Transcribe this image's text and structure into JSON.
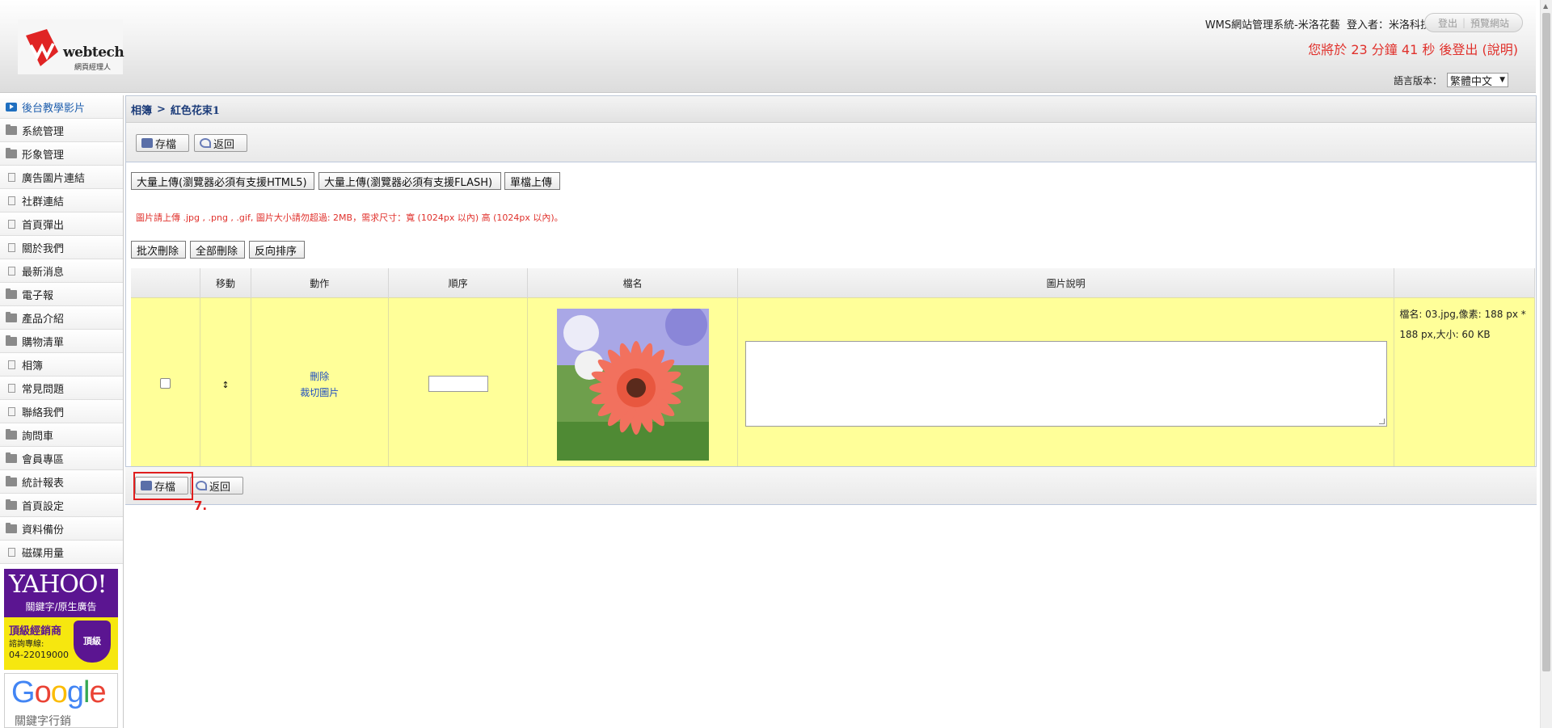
{
  "header": {
    "logo_brand": "webtech",
    "logo_sub": "網頁經理人",
    "system_title": "WMS網站管理系統-米洛花藝",
    "login_label": "登入者：米洛科技",
    "logout_btn": "登出",
    "preview_btn": "預覽網站",
    "logout_timer": "您將於 23 分鐘 41 秒 後登出 (說明)",
    "lang_label": "語言版本：",
    "lang_value": "繁體中文",
    "colors": {
      "timer": "#e0312c",
      "logo_red": "#e02424"
    }
  },
  "sidebar": {
    "items": [
      {
        "label": "後台教學影片",
        "icon": "video-icon",
        "active": true
      },
      {
        "label": "系統管理",
        "icon": "folder-icon"
      },
      {
        "label": "形象管理",
        "icon": "folder-icon"
      },
      {
        "label": "廣告圖片連結",
        "icon": "document-icon"
      },
      {
        "label": "社群連結",
        "icon": "document-icon"
      },
      {
        "label": "首頁彈出",
        "icon": "document-icon"
      },
      {
        "label": "關於我們",
        "icon": "document-icon"
      },
      {
        "label": "最新消息",
        "icon": "document-icon"
      },
      {
        "label": "電子報",
        "icon": "folder-icon"
      },
      {
        "label": "產品介紹",
        "icon": "folder-icon"
      },
      {
        "label": "購物清單",
        "icon": "folder-icon"
      },
      {
        "label": "相簿",
        "icon": "document-icon"
      },
      {
        "label": "常見問題",
        "icon": "document-icon"
      },
      {
        "label": "聯絡我們",
        "icon": "document-icon"
      },
      {
        "label": "詢問車",
        "icon": "folder-icon"
      },
      {
        "label": "會員專區",
        "icon": "folder-icon"
      },
      {
        "label": "統計報表",
        "icon": "folder-icon"
      },
      {
        "label": "首頁設定",
        "icon": "folder-icon"
      },
      {
        "label": "資料備份",
        "icon": "folder-icon"
      },
      {
        "label": "磁碟用量",
        "icon": "document-icon"
      }
    ],
    "ads": {
      "yahoo_logo": "YAHOO!",
      "yahoo_sub": "關鍵字/原生廣告",
      "yahoo_rank": "頂級經銷商",
      "yahoo_hotline": "諮詢專線:",
      "yahoo_tel": "04-22019000",
      "yahoo_badge": "頂級",
      "google_sub": "關鍵字行銷"
    }
  },
  "main": {
    "breadcrumb": {
      "parent": "相簿",
      "separator": ">",
      "current": "紅色花束1"
    },
    "toolbar": {
      "save": "存檔",
      "back": "返回"
    },
    "upload_buttons": [
      "大量上傳(瀏覽器必須有支援HTML5)",
      "大量上傳(瀏覽器必須有支援FLASH)",
      "單檔上傳"
    ],
    "notice": "圖片請上傳 .jpg , .png , .gif, 圖片大小請勿超過: 2MB，需求尺寸：寬 (1024px 以內) 高 (1024px 以內)。",
    "batch_buttons": [
      "批次刪除",
      "全部刪除",
      "反向排序"
    ],
    "table": {
      "headers": [
        "",
        "移動",
        "動作",
        "順序",
        "檔名",
        "圖片說明",
        ""
      ],
      "rows": [
        {
          "move_icon": "↕",
          "action_delete": "刪除",
          "action_crop": "裁切圖片",
          "order_value": "",
          "description": "",
          "info_line1": "檔名: 03.jpg,像素: 188 px *",
          "info_line2": "188 px,大小: 60 KB"
        }
      ]
    },
    "bottom_toolbar": {
      "save": "存檔",
      "back": "返回"
    },
    "annotation_step": "7."
  }
}
